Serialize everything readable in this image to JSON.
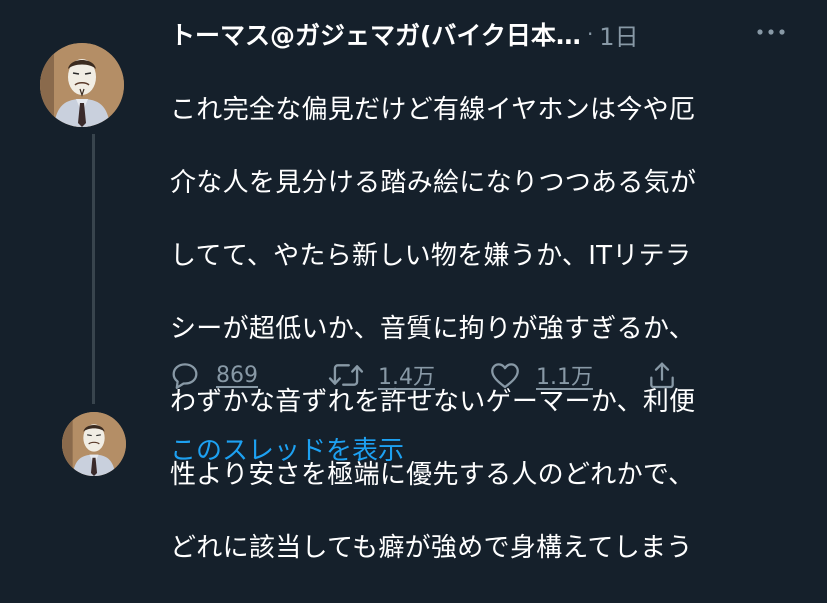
{
  "tweet": {
    "author_name": "トーマス@ガジェマガ(バイク日本…",
    "separator": "·",
    "timestamp": "1日",
    "text_lines": [
      "これ完全な偏見だけど有線イヤホンは今や厄",
      "介な人を見分ける踏み絵になりつつある気が",
      "してて、やたら新しい物を嫌うか、ITリテラ",
      "シーが超低いか、音質に拘りが強すぎるか、",
      "わずかな音ずれを許せないゲーマーか、利便",
      "性より安さを極端に優先する人のどれかで、",
      "どれに該当しても癖が強めで身構えてしまう"
    ],
    "reply_count": "869",
    "retweet_count": "1.4万",
    "like_count": "1.1万"
  },
  "thread": {
    "show_thread_label": "このスレッドを表示"
  },
  "icons": {
    "more": "more-dots-icon",
    "reply": "reply-icon",
    "retweet": "retweet-icon",
    "like": "heart-icon",
    "share": "share-icon"
  },
  "colors": {
    "background": "#15202b",
    "secondary_text": "#8899a6",
    "link": "#1da1f2",
    "thread_line": "#38444d"
  }
}
